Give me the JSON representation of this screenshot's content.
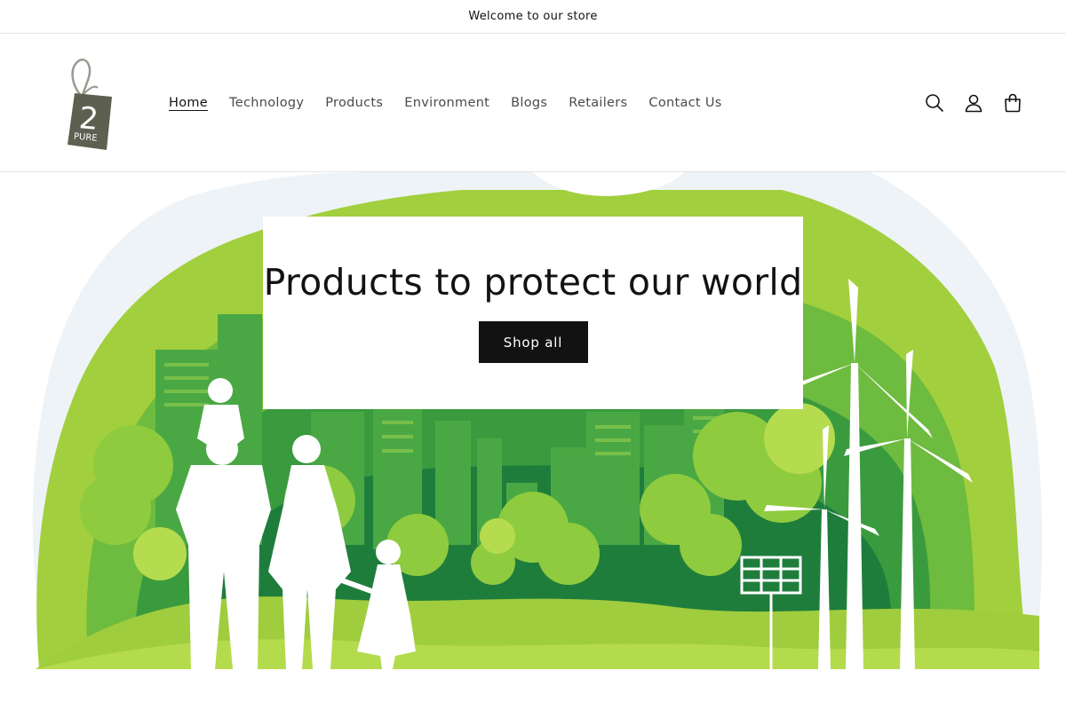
{
  "announcement": {
    "text": "Welcome to our store"
  },
  "logo": {
    "brand_text": "PURE",
    "numeral": "2"
  },
  "nav": [
    {
      "label": "Home",
      "active": true
    },
    {
      "label": "Technology"
    },
    {
      "label": "Products"
    },
    {
      "label": "Environment"
    },
    {
      "label": "Blogs"
    },
    {
      "label": "Retailers"
    },
    {
      "label": "Contact Us"
    }
  ],
  "header_icons": [
    "search-icon",
    "account-icon",
    "cart-icon"
  ],
  "hero": {
    "title": "Products to protect our world",
    "button_label": "Shop all"
  },
  "colors": {
    "text": "#121212",
    "button_bg": "#121212",
    "green_light": "#9fcd3d",
    "green_mid": "#5db23b",
    "green_dark": "#1f7d3c"
  }
}
